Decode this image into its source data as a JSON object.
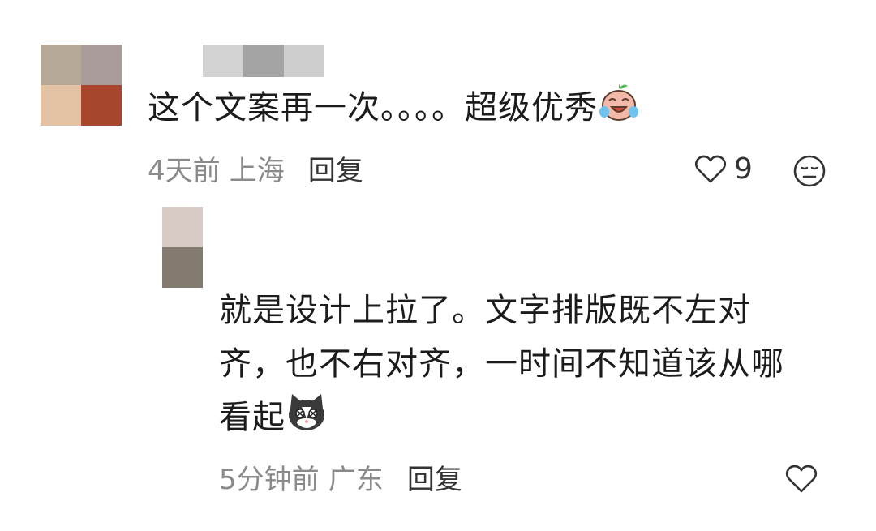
{
  "comments": [
    {
      "text": "这个文案再一次。。。。超级优秀",
      "emoji": "crying-laughing-face-emoji",
      "time": "4天前",
      "location": "上海",
      "reply_label": "回复",
      "like_count": "9",
      "avatar_colors": [
        "#b6a896",
        "#aa9b9b",
        "#e3c3a3",
        "#a6462c"
      ],
      "username_colors": [
        "#d3d3d3",
        "#a4a4a4",
        "#cecece"
      ]
    },
    {
      "lines": [
        "就是设计上拉了。文字排版既不左对",
        "齐，也不右对齐，一时间不知道该从哪",
        "看起"
      ],
      "emoji": "cat-face-emoji",
      "time": "5分钟前",
      "location": "广东",
      "reply_label": "回复",
      "avatar_colors": [
        "#d9ccc6",
        "#837b6f"
      ]
    }
  ],
  "icons": {
    "like": "heart-outline-icon",
    "dislike": "expressionless-face-icon"
  }
}
